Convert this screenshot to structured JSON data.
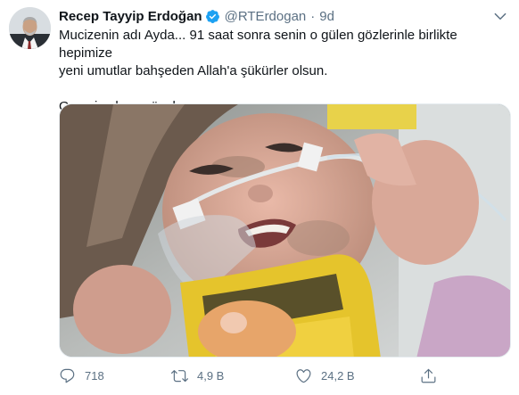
{
  "tweet": {
    "author_name": "Recep Tayyip Erdoğan",
    "handle": "@RTErdogan",
    "separator": "·",
    "time": "9d",
    "verified": true,
    "text_line1": "Mucizenin adı Ayda... 91 saat sonra senin o gülen gözlerinle birlikte hepimize",
    "text_line2": "yeni umutlar bahşeden Allah'a şükürler olsun.",
    "text_line3": "Geçmiş olsun güzel yavrum...",
    "media": {
      "description_icon": "photo",
      "subject": "child-with-neck-brace"
    },
    "actions": {
      "reply_count": "718",
      "retweet_count": "4,9 B",
      "like_count": "24,2 B"
    }
  },
  "colors": {
    "text_primary": "#0f1419",
    "text_secondary": "#5b7083",
    "verified_blue": "#1da1f2"
  }
}
